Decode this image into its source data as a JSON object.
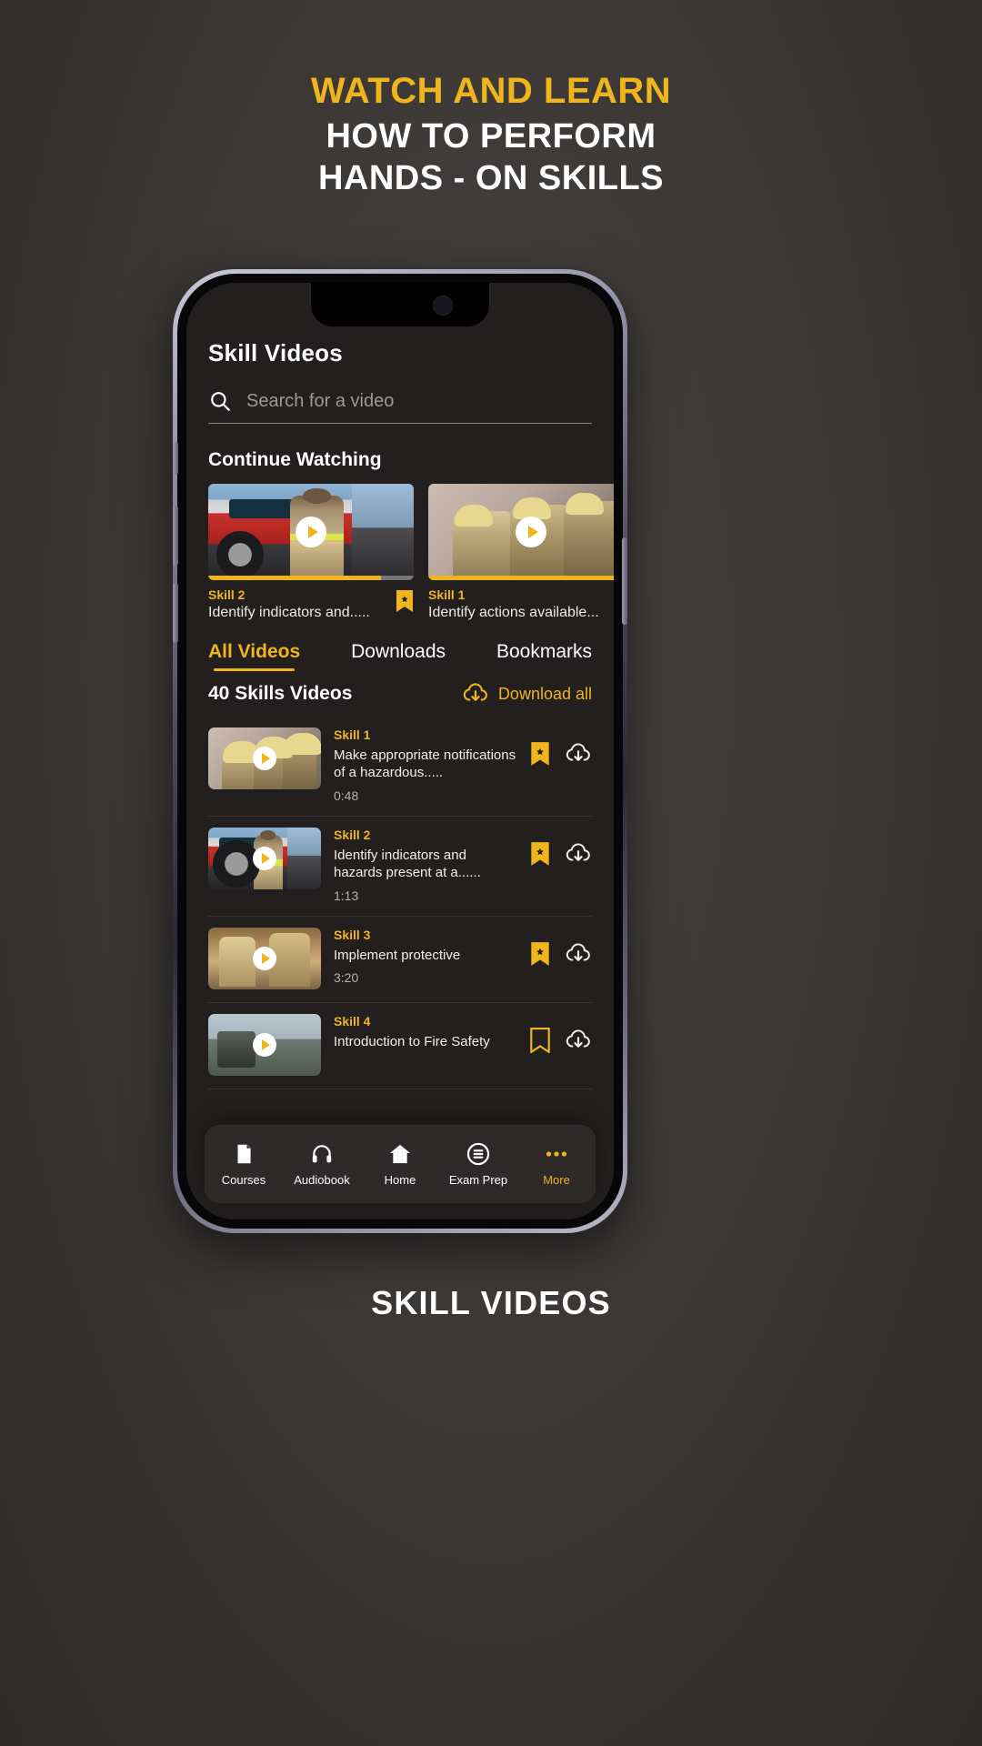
{
  "promo": {
    "line1": "WATCH AND LEARN",
    "line2": "HOW TO PERFORM",
    "line3": "HANDS - ON SKILLS"
  },
  "caption": "SKILL VIDEOS",
  "colors": {
    "accent": "#f0b41c",
    "screen_bg": "#231f1f",
    "nav_bg": "#2e2a29",
    "text": "#ffffff",
    "muted": "#b7b1af"
  },
  "app": {
    "title": "Skill Videos",
    "search": {
      "placeholder": "Search for a video",
      "value": "",
      "icon": "search-icon"
    },
    "continue_watching": {
      "heading": "Continue Watching",
      "items": [
        {
          "skill": "Skill 2",
          "description": "Identify indicators and.....",
          "progress": 84,
          "bookmarked": true,
          "thumb": "fire-truck"
        },
        {
          "skill": "Skill 1",
          "description": "Identify actions available...",
          "progress": 97,
          "bookmarked": true,
          "thumb": "firefighters-smoke"
        }
      ]
    },
    "tabs": [
      {
        "label": "All Videos",
        "active": true
      },
      {
        "label": "Downloads",
        "active": false
      },
      {
        "label": "Bookmarks",
        "active": false
      }
    ],
    "list_header": {
      "count_label": "40 Skills Videos",
      "download_all_label": "Download all",
      "download_all_icon": "cloud-download-icon"
    },
    "videos": [
      {
        "skill": "Skill 1",
        "description": "Make appropriate notifications of  a hazardous.....",
        "duration": "0:48",
        "bookmarked": true,
        "thumb": "firefighters-smoke"
      },
      {
        "skill": "Skill 2",
        "description": "Identify indicators and hazards present at a......",
        "duration": "1:13",
        "bookmarked": true,
        "thumb": "fire-truck"
      },
      {
        "skill": "Skill 3",
        "description": "Implement protective",
        "duration": "3:20",
        "bookmarked": true,
        "thumb": "firefighter-gear"
      },
      {
        "skill": "Skill 4",
        "description": "Introduction to Fire Safety",
        "duration": "",
        "bookmarked": false,
        "thumb": "fire-field"
      }
    ],
    "bottom_nav": [
      {
        "label": "Courses",
        "icon": "book-icon",
        "active": false
      },
      {
        "label": "Audiobook",
        "icon": "headphones-icon",
        "active": false
      },
      {
        "label": "Home",
        "icon": "home-icon",
        "active": false
      },
      {
        "label": "Exam Prep",
        "icon": "list-icon",
        "active": false
      },
      {
        "label": "More",
        "icon": "ellipsis-icon",
        "active": true
      }
    ]
  }
}
